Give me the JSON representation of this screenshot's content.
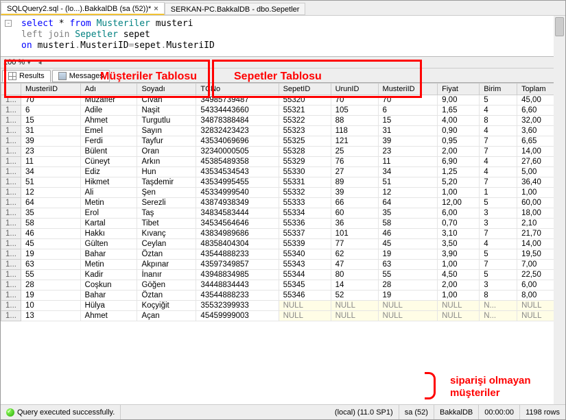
{
  "tabs": [
    {
      "label": "SQLQuery2.sql - (lo...).BakkalDB (sa (52))*",
      "active": true
    },
    {
      "label": "SERKAN-PC.BakkalDB - dbo.Sepetler",
      "active": false
    }
  ],
  "sql": {
    "line1_kw1": "select",
    "line1_rest": " * ",
    "line1_kw2": "from",
    "line1_tbl": " Musteriler ",
    "line1_alias": "musteri",
    "line2_kw": "left join",
    "line2_tbl": " Sepetler ",
    "line2_alias": "sepet",
    "line3_kw": "on",
    "line3_rest": " musteri",
    "line3_dot1": ".",
    "line3_c1": "MusteriID",
    "line3_eq": "=",
    "line3_r2": "sepet",
    "line3_dot2": ".",
    "line3_c2": "MusteriID"
  },
  "zoom": "100 %",
  "results_tab": "Results",
  "messages_tab": "Messages",
  "columns": [
    "",
    "MusteriID",
    "Adı",
    "Soyadı",
    "TCNo",
    "SepetID",
    "UrunID",
    "MusteriID",
    "Fiyat",
    "Birim",
    "Toplam"
  ],
  "rows": [
    [
      "1...",
      "70",
      "Muzaffer",
      "Cıvan",
      "34985739487",
      "55320",
      "70",
      "70",
      "9,00",
      "5",
      "45,00"
    ],
    [
      "1...",
      "6",
      "Adile",
      "Naşit",
      "54334443660",
      "55321",
      "105",
      "6",
      "1,65",
      "4",
      "6,60"
    ],
    [
      "1...",
      "15",
      "Ahmet",
      "Turgutlu",
      "34878388484",
      "55322",
      "88",
      "15",
      "4,00",
      "8",
      "32,00"
    ],
    [
      "1...",
      "31",
      "Emel",
      "Sayın",
      "32832423423",
      "55323",
      "118",
      "31",
      "0,90",
      "4",
      "3,60"
    ],
    [
      "1...",
      "39",
      "Ferdi",
      "Tayfur",
      "43534069696",
      "55325",
      "121",
      "39",
      "0,95",
      "7",
      "6,65"
    ],
    [
      "1...",
      "23",
      "Bülent",
      "Oran",
      "32340000505",
      "55328",
      "25",
      "23",
      "2,00",
      "7",
      "14,00"
    ],
    [
      "1...",
      "11",
      "Cüneyt",
      "Arkın",
      "45385489358",
      "55329",
      "76",
      "11",
      "6,90",
      "4",
      "27,60"
    ],
    [
      "1...",
      "34",
      "Ediz",
      "Hun",
      "43534534543",
      "55330",
      "27",
      "34",
      "1,25",
      "4",
      "5,00"
    ],
    [
      "1...",
      "51",
      "Hikmet",
      "Taşdemir",
      "43534995455",
      "55331",
      "89",
      "51",
      "5,20",
      "7",
      "36,40"
    ],
    [
      "1...",
      "12",
      "Ali",
      "Şen",
      "45334999540",
      "55332",
      "39",
      "12",
      "1,00",
      "1",
      "1,00"
    ],
    [
      "1...",
      "64",
      "Metin",
      "Serezli",
      "43874938349",
      "55333",
      "66",
      "64",
      "12,00",
      "5",
      "60,00"
    ],
    [
      "1...",
      "35",
      "Erol",
      "Taş",
      "34834583444",
      "55334",
      "60",
      "35",
      "6,00",
      "3",
      "18,00"
    ],
    [
      "1...",
      "58",
      "Kartal",
      "Tibet",
      "34534564646",
      "55336",
      "36",
      "58",
      "0,70",
      "3",
      "2,10"
    ],
    [
      "1...",
      "46",
      "Hakkı",
      "Kıvanç",
      "43834989686",
      "55337",
      "101",
      "46",
      "3,10",
      "7",
      "21,70"
    ],
    [
      "1...",
      "45",
      "Gülten",
      "Ceylan",
      "48358404304",
      "55339",
      "77",
      "45",
      "3,50",
      "4",
      "14,00"
    ],
    [
      "1...",
      "19",
      "Bahar",
      "Öztan",
      "43544888233",
      "55340",
      "62",
      "19",
      "3,90",
      "5",
      "19,50"
    ],
    [
      "1...",
      "63",
      "Metin",
      "Akpınar",
      "43597349857",
      "55343",
      "47",
      "63",
      "1,00",
      "7",
      "7,00"
    ],
    [
      "1...",
      "55",
      "Kadir",
      "İnanır",
      "43948834985",
      "55344",
      "80",
      "55",
      "4,50",
      "5",
      "22,50"
    ],
    [
      "1...",
      "28",
      "Coşkun",
      "Göğen",
      "34448834443",
      "55345",
      "14",
      "28",
      "2,00",
      "3",
      "6,00"
    ],
    [
      "1...",
      "19",
      "Bahar",
      "Öztan",
      "43544888233",
      "55346",
      "52",
      "19",
      "1,00",
      "8",
      "8,00"
    ],
    [
      "1...",
      "10",
      "Hülya",
      "Koçyiğit",
      "35532399933",
      "NULL",
      "NULL",
      "NULL",
      "NULL",
      "N...",
      "NULL"
    ],
    [
      "1...",
      "13",
      "Ahmet",
      "Açan",
      "45459999003",
      "NULL",
      "NULL",
      "NULL",
      "NULL",
      "N...",
      "NULL"
    ]
  ],
  "status": {
    "msg": "Query executed successfully.",
    "conn": "(local) (11.0 SP1)",
    "user": "sa (52)",
    "db": "BakkalDB",
    "time": "00:00:00",
    "rows": "1198 rows"
  },
  "annotations": {
    "left": "Müşteriler Tablosu",
    "right": "Sepetler Tablosu",
    "note1": "siparişi olmayan",
    "note2": "müşteriler"
  }
}
